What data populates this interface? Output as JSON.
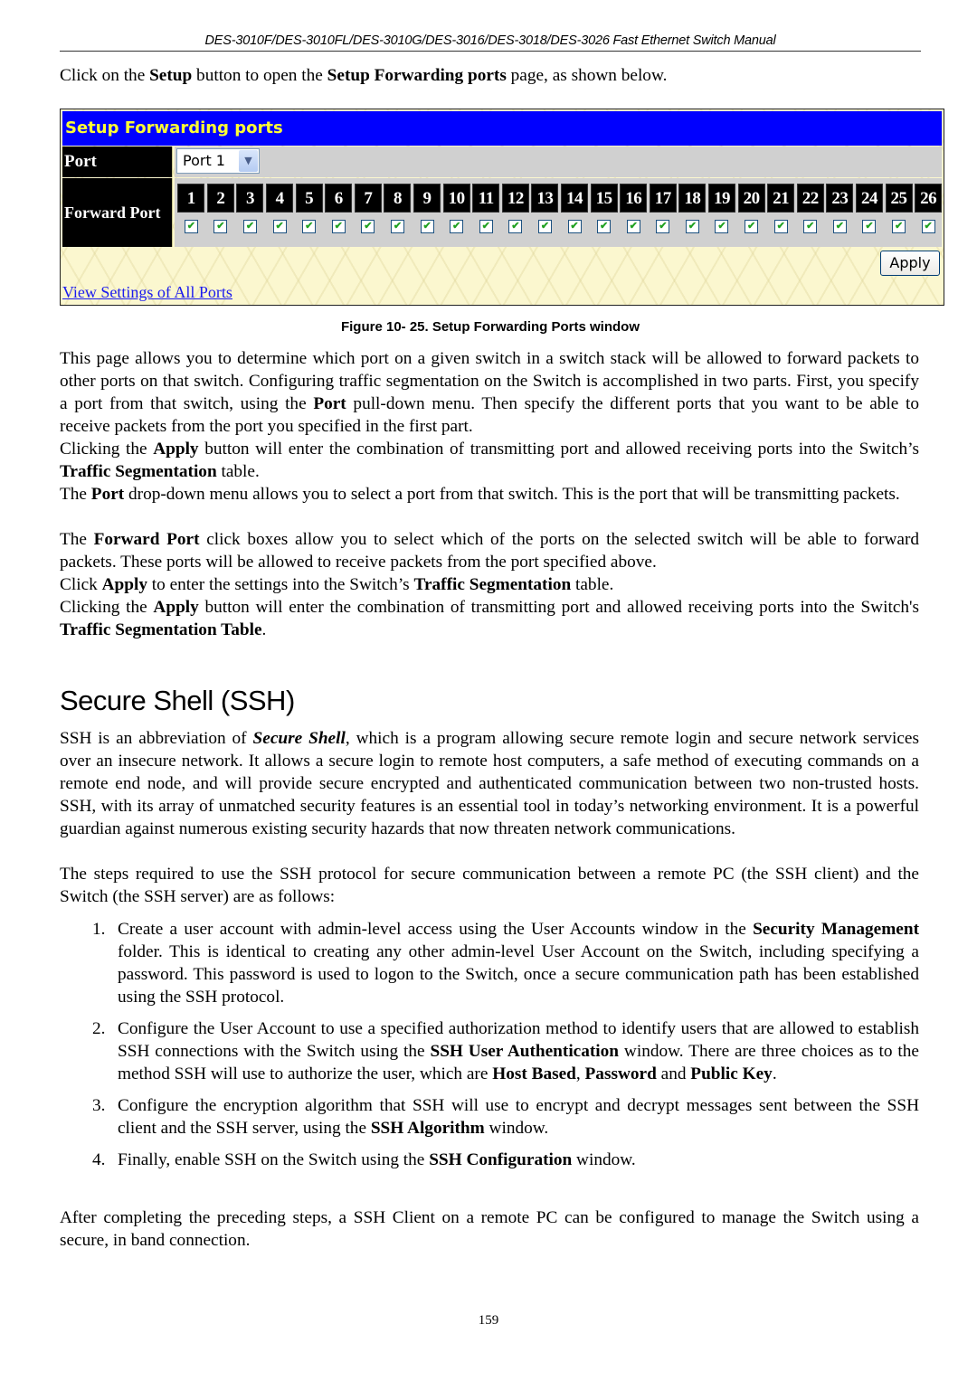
{
  "running_header": "DES-3010F/DES-3010FL/DES-3010G/DES-3016/DES-3018/DES-3026 Fast Ethernet Switch Manual",
  "intro": {
    "t1": "Click on the ",
    "b1": "Setup",
    "t2": " button to open the ",
    "b2": "Setup Forwarding ports",
    "t3": " page, as shown below."
  },
  "figure": {
    "title": "Setup Forwarding ports",
    "port_label": "Port",
    "port_selected": "Port 1",
    "forward_label": "Forward Port",
    "ports": [
      {
        "num": "1",
        "checked": true
      },
      {
        "num": "2",
        "checked": true
      },
      {
        "num": "3",
        "checked": true
      },
      {
        "num": "4",
        "checked": true
      },
      {
        "num": "5",
        "checked": true
      },
      {
        "num": "6",
        "checked": true
      },
      {
        "num": "7",
        "checked": true
      },
      {
        "num": "8",
        "checked": true
      },
      {
        "num": "9",
        "checked": true
      },
      {
        "num": "10",
        "checked": true
      },
      {
        "num": "11",
        "checked": true
      },
      {
        "num": "12",
        "checked": true
      },
      {
        "num": "13",
        "checked": true
      },
      {
        "num": "14",
        "checked": true
      },
      {
        "num": "15",
        "checked": true
      },
      {
        "num": "16",
        "checked": true
      },
      {
        "num": "17",
        "checked": true
      },
      {
        "num": "18",
        "checked": true
      },
      {
        "num": "19",
        "checked": true
      },
      {
        "num": "20",
        "checked": true
      },
      {
        "num": "21",
        "checked": true
      },
      {
        "num": "22",
        "checked": true
      },
      {
        "num": "23",
        "checked": true
      },
      {
        "num": "24",
        "checked": true
      },
      {
        "num": "25",
        "checked": true
      },
      {
        "num": "26",
        "checked": true
      }
    ],
    "apply_label": "Apply",
    "view_link": "View Settings of All Ports",
    "colors": {
      "title_bg": "#0000ff",
      "title_fg": "#ffff33",
      "label_bg": "#000000",
      "cell_bg": "#d0d0d0",
      "check": "#21a121"
    }
  },
  "caption": "Figure 10- 25. Setup Forwarding Ports window",
  "p1": {
    "t1": "This page allows you to determine which port on a given switch in a switch stack will be allowed to forward packets to other ports on that switch. Configuring traffic segmentation on the Switch is accomplished in two parts. First, you specify a port from that switch, using the ",
    "b1": "Port",
    "t2": " pull-down menu. Then specify the different ports that you want to be able to receive packets from the port you specified in the first part."
  },
  "p2": {
    "t1": "Clicking the ",
    "b1": "Apply",
    "t2": " button will enter the combination of transmitting port and allowed receiving ports into the Switch’s ",
    "b2": "Traffic Segmentation",
    "t3": " table."
  },
  "p3": {
    "t1": "The ",
    "b1": "Port",
    "t2": " drop-down menu allows you to select a port from that switch. This is the port that will be transmitting packets."
  },
  "p4": {
    "t1": "The ",
    "b1": "Forward Port",
    "t2": " click boxes allow you to select which of the ports on the selected switch will be able to forward packets. These ports will be allowed to receive packets from the port specified above."
  },
  "p5": {
    "t1": "Click ",
    "b1": "Apply",
    "t2": " to enter the settings into the Switch’s ",
    "b2": "Traffic Segmentation",
    "t3": " table."
  },
  "p6": {
    "t1": "Clicking the ",
    "b1": "Apply",
    "t2": " button will enter the combination of transmitting port and allowed receiving ports into the Switch's ",
    "b2": "Traffic Segmentation Table",
    "t3": "."
  },
  "ssh_heading": "Secure Shell (SSH)",
  "s1": {
    "t1": "SSH is an abbreviation of ",
    "bi1": "Secure Shell",
    "t2": ", which is a program allowing secure remote login and secure network services over an insecure network. It allows a secure login to remote host computers, a safe method of executing commands on a remote end node, and will provide secure encrypted and authenticated communication between two non-trusted hosts. SSH, with its array of unmatched security features is an essential tool in today’s networking environment. It is a powerful guardian against numerous existing security hazards that now threaten network communications."
  },
  "s2": "The steps required to use the SSH protocol for secure communication between a remote PC (the SSH client) and the Switch (the SSH server) are as follows:",
  "steps": [
    {
      "num": "1.",
      "t1": "Create a user account with admin-level access using the User Accounts window in the ",
      "b1": "Security Management",
      "t2": " folder. This is identical to creating any other admin-level User Account on the Switch, including specifying a password. This password is used to logon to the Switch, once a secure communication path has been established using the SSH protocol."
    },
    {
      "num": "2.",
      "t1": "Configure the User Account to use a specified authorization method to identify users that are allowed to establish SSH connections with the Switch using the ",
      "b1": "SSH User Authentication",
      "t2": " window. There are three choices as to the method SSH will use to authorize the user, which are ",
      "b2": "Host Based",
      "t3": ", ",
      "b3": "Password",
      "t4": " and ",
      "b4": "Public Key",
      "t5": "."
    },
    {
      "num": "3.",
      "t1": "Configure the encryption algorithm that SSH will use to encrypt and decrypt messages sent between the SSH client and the SSH server, using the ",
      "b1": "SSH Algorithm",
      "t2": " window."
    },
    {
      "num": "4.",
      "t1": "Finally, enable SSH on the Switch using the ",
      "b1": "SSH Configuration",
      "t2": " window."
    }
  ],
  "s3": "After completing the preceding steps, a SSH Client on a remote PC can be configured to manage the Switch using a secure, in band connection.",
  "page_number": "159"
}
